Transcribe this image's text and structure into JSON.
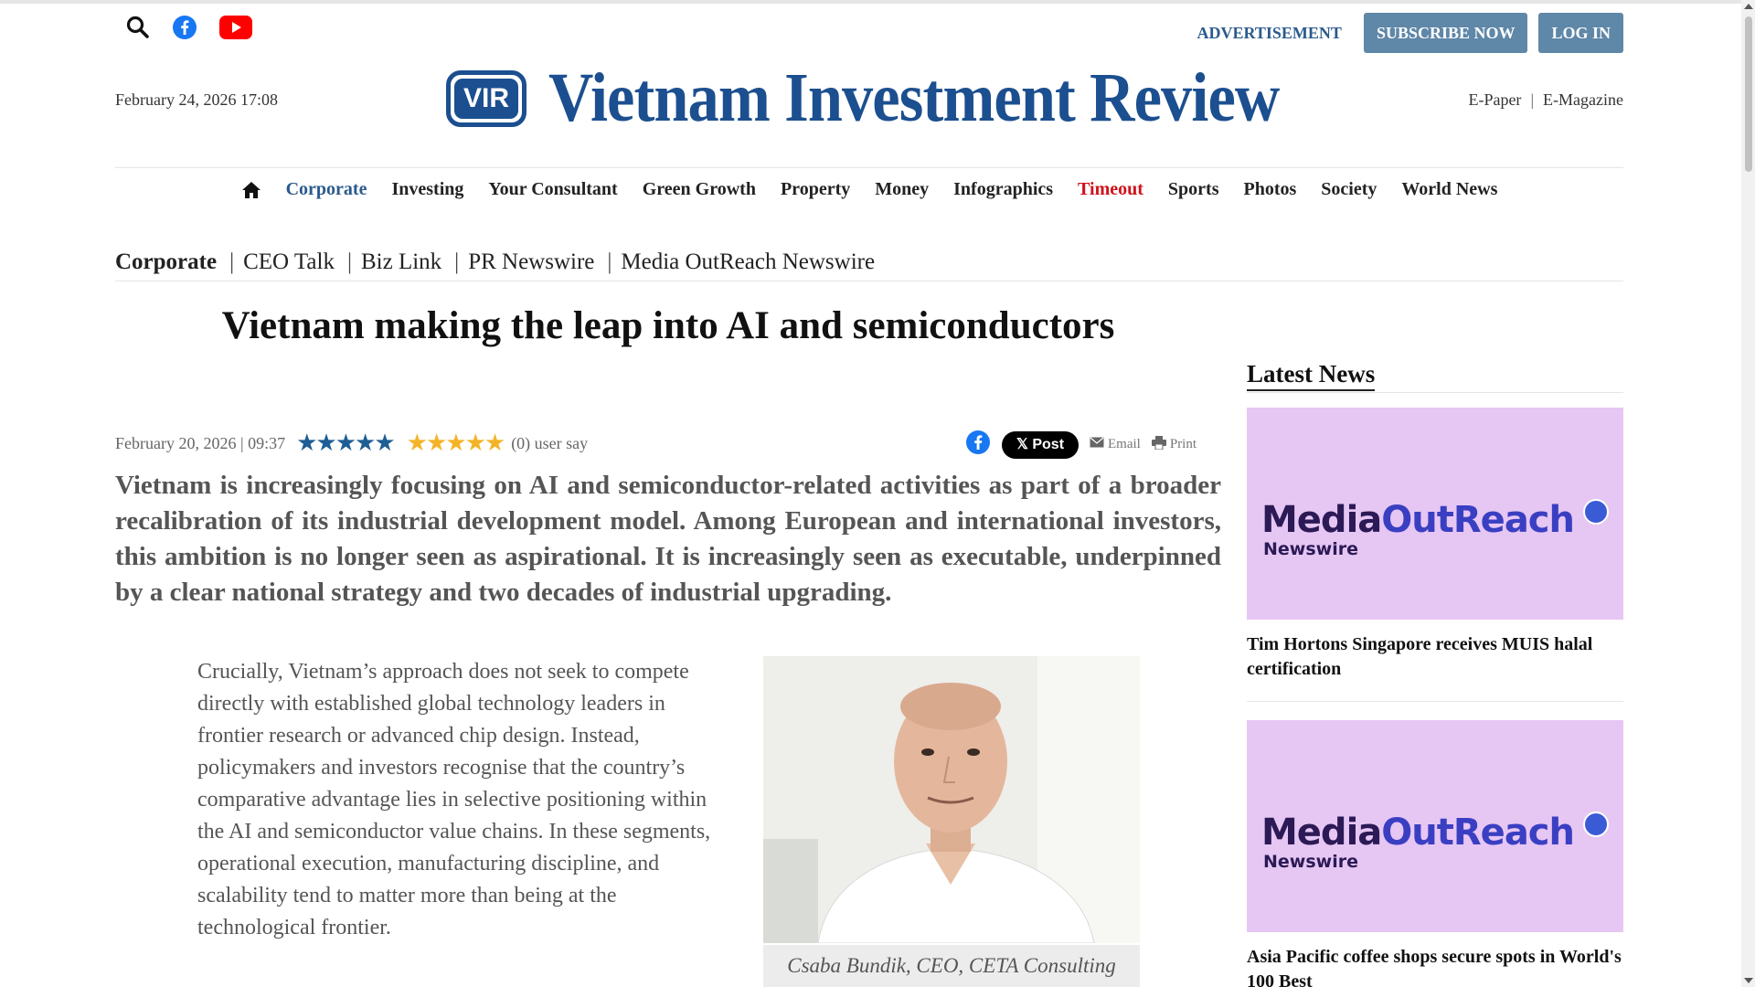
{
  "topbar": {
    "advertisement": "ADVERTISEMENT",
    "subscribe": "SUBSCRIBE NOW",
    "login": "LOG IN"
  },
  "masthead": {
    "date": "February 24, 2026 17:08",
    "logo_badge": "VIR",
    "logo_text": "Vietnam Investment Review",
    "epaper": "E-Paper",
    "separator": "|",
    "emagazine": "E-Magazine"
  },
  "nav": {
    "items": [
      "Corporate",
      "Investing",
      "Your Consultant",
      "Green Growth",
      "Property",
      "Money",
      "Infographics",
      "Timeout",
      "Sports",
      "Photos",
      "Society",
      "World News"
    ]
  },
  "subnav": {
    "section": "Corporate",
    "pipe": "|",
    "items": [
      "CEO Talk",
      "Biz Link",
      "PR Newswire",
      "Media OutReach Newswire"
    ]
  },
  "article": {
    "title": "Vietnam making the leap into AI and semiconductors",
    "date": "February 20, 2026 | 09:37",
    "rating_stars": "★★★★★",
    "user_say": "(0) user say",
    "share": {
      "post": "Post",
      "email": "Email",
      "print": "Print"
    },
    "lead": "Vietnam is increasingly focusing on AI and semiconductor-related activities as part of a broader recalibration of its industrial development model. Among European and international investors, this ambition is no longer seen as aspirational. It is increasingly seen as executable, underpinned by a clear national strategy and two decades of industrial upgrading.",
    "body": "Crucially, Vietnam’s approach does not seek to compete directly with established global technology leaders in frontier research or advanced chip design. Instead, policymakers and investors recognise that the country’s comparative advantage lies in selective positioning within the AI and semiconductor value chains. In these segments, operational execution, manufacturing discipline, and scalability tend to matter more than being at the technological frontier.",
    "photo_caption": "Csaba Bundik, CEO, CETA Consulting"
  },
  "sidebar": {
    "heading": "Latest News",
    "logo_part1": "Media",
    "logo_part2": "OutReach",
    "logo_sub": "Newswire",
    "cards": [
      {
        "title": "Tim Hortons Singapore receives MUIS halal certification"
      },
      {
        "title": "Asia Pacific coffee shops secure spots in World's 100 Best"
      }
    ]
  },
  "colors": {
    "brand_blue": "#1c4f8f",
    "button": "#5f87a8",
    "timeout_red": "#d0111a",
    "card_bg": "#e6c6f3"
  }
}
